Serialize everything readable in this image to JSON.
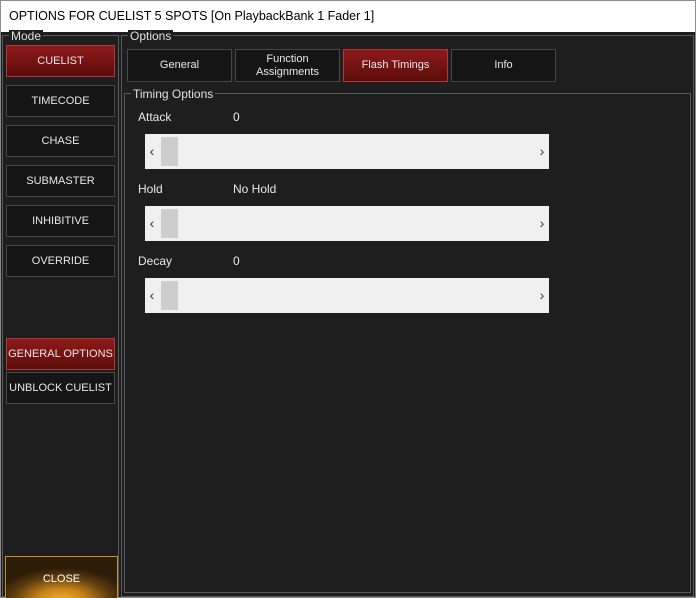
{
  "window": {
    "title": "OPTIONS FOR CUELIST 5 SPOTS  [On PlaybackBank 1 Fader 1]"
  },
  "mode": {
    "label": "Mode",
    "buttons": [
      {
        "label": "CUELIST",
        "active": true
      },
      {
        "label": "TIMECODE",
        "active": false
      },
      {
        "label": "CHASE",
        "active": false
      },
      {
        "label": "SUBMASTER",
        "active": false
      },
      {
        "label": "INHIBITIVE",
        "active": false
      },
      {
        "label": "OVERRIDE",
        "active": false
      }
    ],
    "general_options_label": "GENERAL OPTIONS",
    "unblock_label": "UNBLOCK CUELIST",
    "close_label": "CLOSE"
  },
  "options": {
    "label": "Options",
    "tabs": [
      {
        "label": "General",
        "active": false
      },
      {
        "label": "Function Assignments",
        "active": false
      },
      {
        "label": "Flash Timings",
        "active": true
      },
      {
        "label": "Info",
        "active": false
      }
    ]
  },
  "timing": {
    "label": "Timing Options",
    "items": [
      {
        "label": "Attack",
        "value": "0",
        "slider_fraction": 0.0
      },
      {
        "label": "Hold",
        "value": "No Hold",
        "slider_fraction": 0.0
      },
      {
        "label": "Decay",
        "value": "0",
        "slider_fraction": 0.0
      }
    ]
  },
  "icons": {
    "scroll_left": "scroll-left-icon",
    "scroll_right": "scroll-right-icon"
  },
  "colors": {
    "active_red": "#7a1414",
    "close_orange": "#f3b02e",
    "panel_bg": "#1e1e1e"
  }
}
